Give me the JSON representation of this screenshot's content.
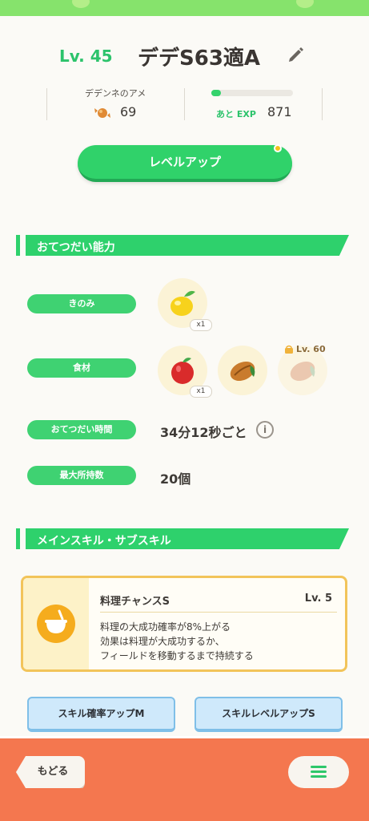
{
  "header": {
    "level": "Lv. 45",
    "name": "デデS63適A"
  },
  "stats": {
    "candy_label": "デデンネのアメ",
    "candy_count": "69",
    "exp_label": "あと EXP",
    "exp_value": "871",
    "exp_progress": 0.12
  },
  "level_up_label": "レベルアップ",
  "helping": {
    "section_title": "おてつだい能力",
    "berry_label": "きのみ",
    "berry_count": "x1",
    "ingredient_label": "食材",
    "ingredient_count": "x1",
    "locked_level": "Lv. 60",
    "time_label": "おてつだい時間",
    "time_value": "34分12秒ごと",
    "info_glyph": "i",
    "carry_label": "最大所持数",
    "carry_value": "20個"
  },
  "skills": {
    "section_title": "メインスキル・サブスキル",
    "main_skill_name": "料理チャンスS",
    "main_skill_level": "Lv. 5",
    "main_skill_desc": [
      "料理の大成功確率が8%上がる",
      "効果は料理が大成功するか、",
      "フィールドを移動するまで持続する"
    ],
    "sub_skills": [
      "スキル確率アップM",
      "スキルレベルアップS"
    ]
  },
  "footer": {
    "back_label": "もどる"
  },
  "colors": {
    "accent": "#2ed16c",
    "footer": "#f4774f",
    "skill_border": "#f2c45a",
    "sub_skill": "#cfe9fb"
  }
}
